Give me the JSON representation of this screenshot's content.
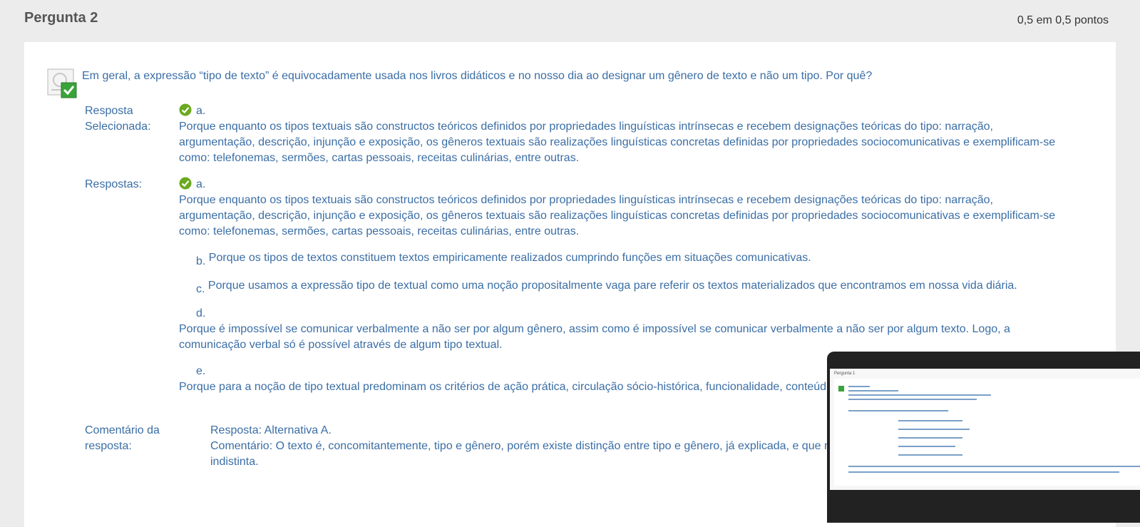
{
  "header": {
    "title": "Pergunta 2",
    "points": "0,5 em 0,5 pontos"
  },
  "question": {
    "text": "Em geral, a expressão “tipo de texto” é equivocadamente usada nos livros didáticos e no nosso dia ao designar um gênero de texto e não um tipo. Por quê?"
  },
  "selected": {
    "label": "Resposta Selecionada:",
    "letter": "a.",
    "text": "Porque enquanto os tipos textuais são constructos teóricos definidos por propriedades linguísticas intrínsecas e recebem designações teóricas do tipo: narração, argumentação, descrição, injunção e exposição, os gêneros textuais são realizações linguísticas concretas definidas por propriedades sociocomunicativas e exemplificam-se como: telefonemas, sermões, cartas pessoais, receitas culinárias, entre outras."
  },
  "answers": {
    "label": "Respostas:",
    "options": [
      {
        "letter": "a.",
        "text": "Porque enquanto os tipos textuais são constructos teóricos definidos por propriedades linguísticas intrínsecas e recebem designações teóricas do tipo: narração, argumentação, descrição, injunção e exposição, os gêneros textuais são realizações linguísticas concretas definidas por propriedades sociocomunicativas e exemplificam-se como: telefonemas, sermões, cartas pessoais, receitas culinárias, entre outras."
      },
      {
        "letter": "b.",
        "text": "Porque os tipos de textos constituem textos empiricamente realizados cumprindo funções em situações comunicativas."
      },
      {
        "letter": "c.",
        "text": "Porque usamos a expressão tipo de textual como uma noção propositalmente vaga pare referir os textos materializados que encontramos em nossa vida diária."
      },
      {
        "letter": "d.",
        "text": "Porque é impossível se comunicar verbalmente a não ser por algum gênero, assim como é impossível se comunicar verbalmente a não ser por algum texto. Logo, a comunicação verbal só é possível através de algum tipo textual."
      },
      {
        "letter": "e.",
        "text": "Porque para a noção de tipo textual predominam os critérios de ação prática, circulação sócio-histórica, funcionalidade, conteúdo temático, estilo e composicionalidade."
      }
    ]
  },
  "feedback": {
    "label": "Comentário da resposta:",
    "line1": "Resposta: Alternativa A.",
    "line2": "Comentário: O texto é, concomitantemente, tipo e gênero, porém existe distinção entre tipo e gênero, já explicada, e que não devem ser empregado de forma indistinta."
  },
  "thumbnail": {
    "title": "Pergunta 1"
  },
  "colors": {
    "accent": "#3b6ea5",
    "check": "#6aaa1e",
    "background": "#ececec"
  }
}
